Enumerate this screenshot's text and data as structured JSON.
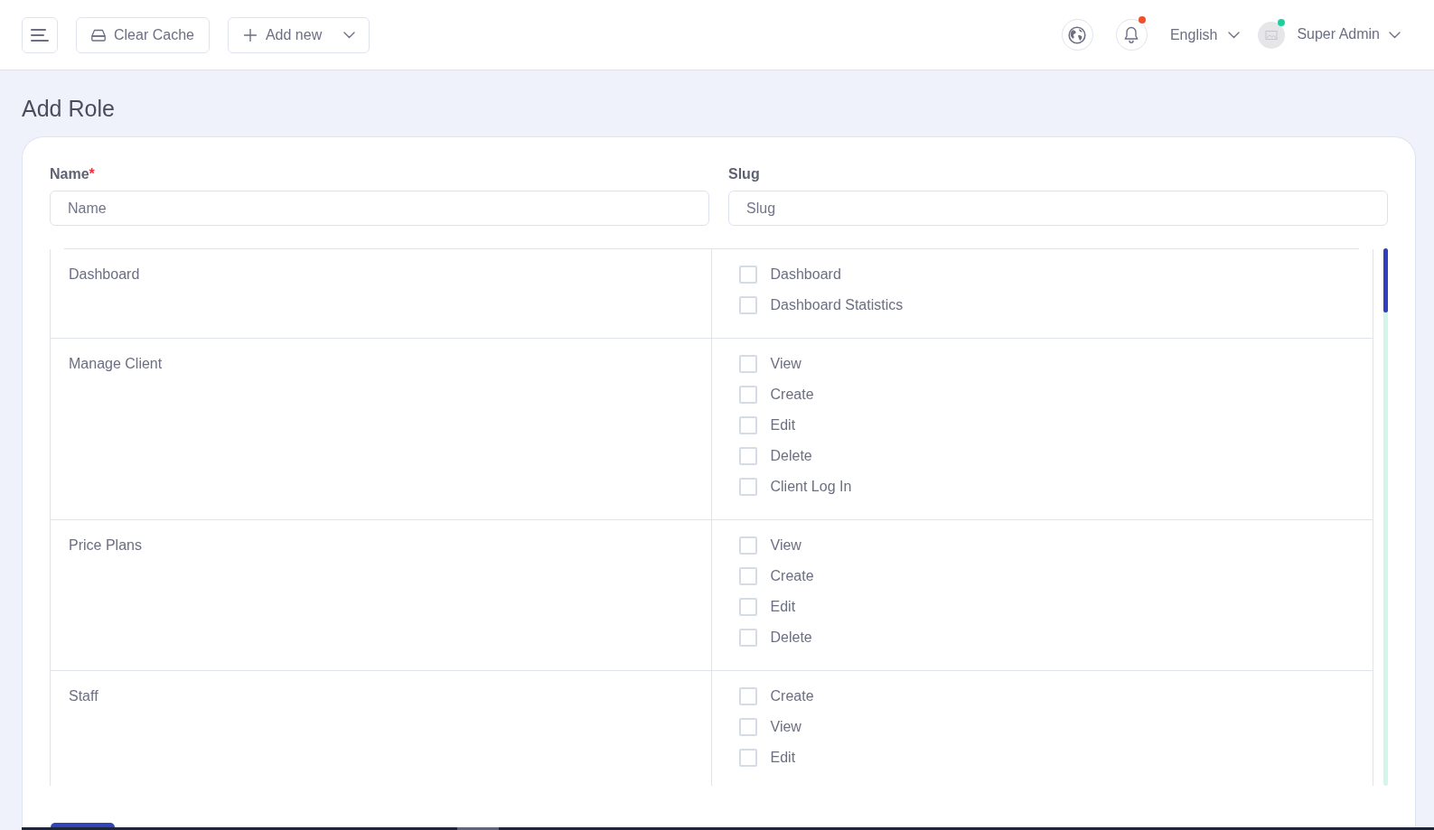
{
  "topbar": {
    "clear_cache_button": {
      "label": "Clear Cache"
    },
    "add_new_button": {
      "label": "Add new"
    },
    "notifications": {
      "unread": true
    },
    "language": {
      "label": "English"
    },
    "user": {
      "name": "Super Admin",
      "online": true
    }
  },
  "page": {
    "title": "Add Role"
  },
  "form": {
    "fields": [
      {
        "label": "Name",
        "required_mark": "*",
        "placeholder": "Name"
      },
      {
        "label": "Slug",
        "placeholder": "Slug"
      }
    ],
    "permission_groups": [
      {
        "name": "Dashboard",
        "permissions": [
          {
            "label": "Dashboard",
            "checked": false
          },
          {
            "label": "Dashboard Statistics",
            "checked": false
          }
        ]
      },
      {
        "name": "Manage Client",
        "permissions": [
          {
            "label": "View",
            "checked": false
          },
          {
            "label": "Create",
            "checked": false
          },
          {
            "label": "Edit",
            "checked": false
          },
          {
            "label": "Delete",
            "checked": false
          },
          {
            "label": "Client Log In",
            "checked": false
          }
        ]
      },
      {
        "name": "Price Plans",
        "permissions": [
          {
            "label": "View",
            "checked": false
          },
          {
            "label": "Create",
            "checked": false
          },
          {
            "label": "Edit",
            "checked": false
          },
          {
            "label": "Delete",
            "checked": false
          }
        ]
      },
      {
        "name": "Staff",
        "permissions": [
          {
            "label": "Create",
            "checked": false
          },
          {
            "label": "View",
            "checked": false
          },
          {
            "label": "Edit",
            "checked": false
          }
        ]
      }
    ]
  }
}
